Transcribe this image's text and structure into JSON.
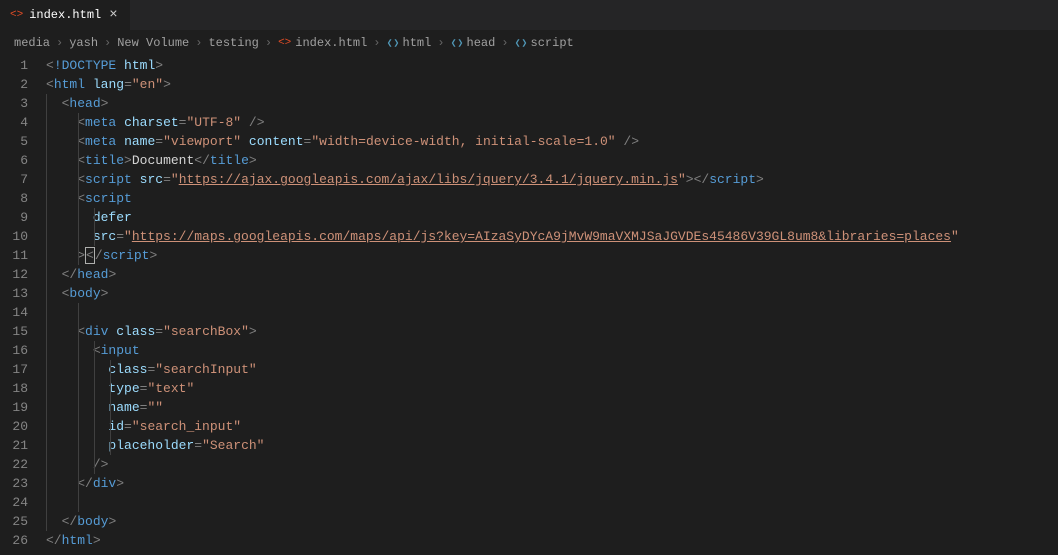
{
  "tab": {
    "icon_label": "<>",
    "name": "index.html",
    "close": "×"
  },
  "breadcrumb": {
    "items": [
      {
        "type": "folder",
        "label": "media"
      },
      {
        "type": "folder",
        "label": "yash"
      },
      {
        "type": "folder",
        "label": "New Volume"
      },
      {
        "type": "folder",
        "label": "testing"
      },
      {
        "type": "file",
        "label": "index.html",
        "icon": "<>"
      },
      {
        "type": "symbol",
        "label": "html"
      },
      {
        "type": "symbol",
        "label": "head"
      },
      {
        "type": "symbol",
        "label": "script"
      }
    ],
    "separator": "›"
  },
  "lines": {
    "count": 26,
    "l1_doctype": "!DOCTYPE",
    "l1_html": "html",
    "l2_html": "html",
    "l2_lang": "lang",
    "l2_lang_v": "\"en\"",
    "l3_head": "head",
    "l4_meta": "meta",
    "l4_charset": "charset",
    "l4_charset_v": "\"UTF-8\"",
    "l5_meta": "meta",
    "l5_name": "name",
    "l5_name_v": "\"viewport\"",
    "l5_content": "content",
    "l5_content_v": "\"width=device-width, initial-scale=1.0\"",
    "l6_title": "title",
    "l6_title_text": "Document",
    "l7_script": "script",
    "l7_src": "src",
    "l7_src_q": "\"",
    "l7_src_v": "https://ajax.googleapis.com/ajax/libs/jquery/3.4.1/jquery.min.js",
    "l8_script": "script",
    "l9_defer": "defer",
    "l10_src": "src",
    "l10_src_q": "\"",
    "l10_src_v": "https://maps.googleapis.com/maps/api/js?key=AIzaSyDYcA9jMvW9maVXMJSaJGVDEs45486V39GL8um8&libraries=places",
    "l11_script": "script",
    "l12_head": "head",
    "l13_body": "body",
    "l15_div": "div",
    "l15_class": "class",
    "l15_class_v": "\"searchBox\"",
    "l16_input": "input",
    "l17_class": "class",
    "l17_class_v": "\"searchInput\"",
    "l18_type": "type",
    "l18_type_v": "\"text\"",
    "l19_name": "name",
    "l19_name_v": "\"\"",
    "l20_id": "id",
    "l20_id_v": "\"search_input\"",
    "l21_placeholder": "placeholder",
    "l21_placeholder_v": "\"Search\"",
    "l23_div": "div",
    "l25_body": "body",
    "l26_html": "html"
  }
}
